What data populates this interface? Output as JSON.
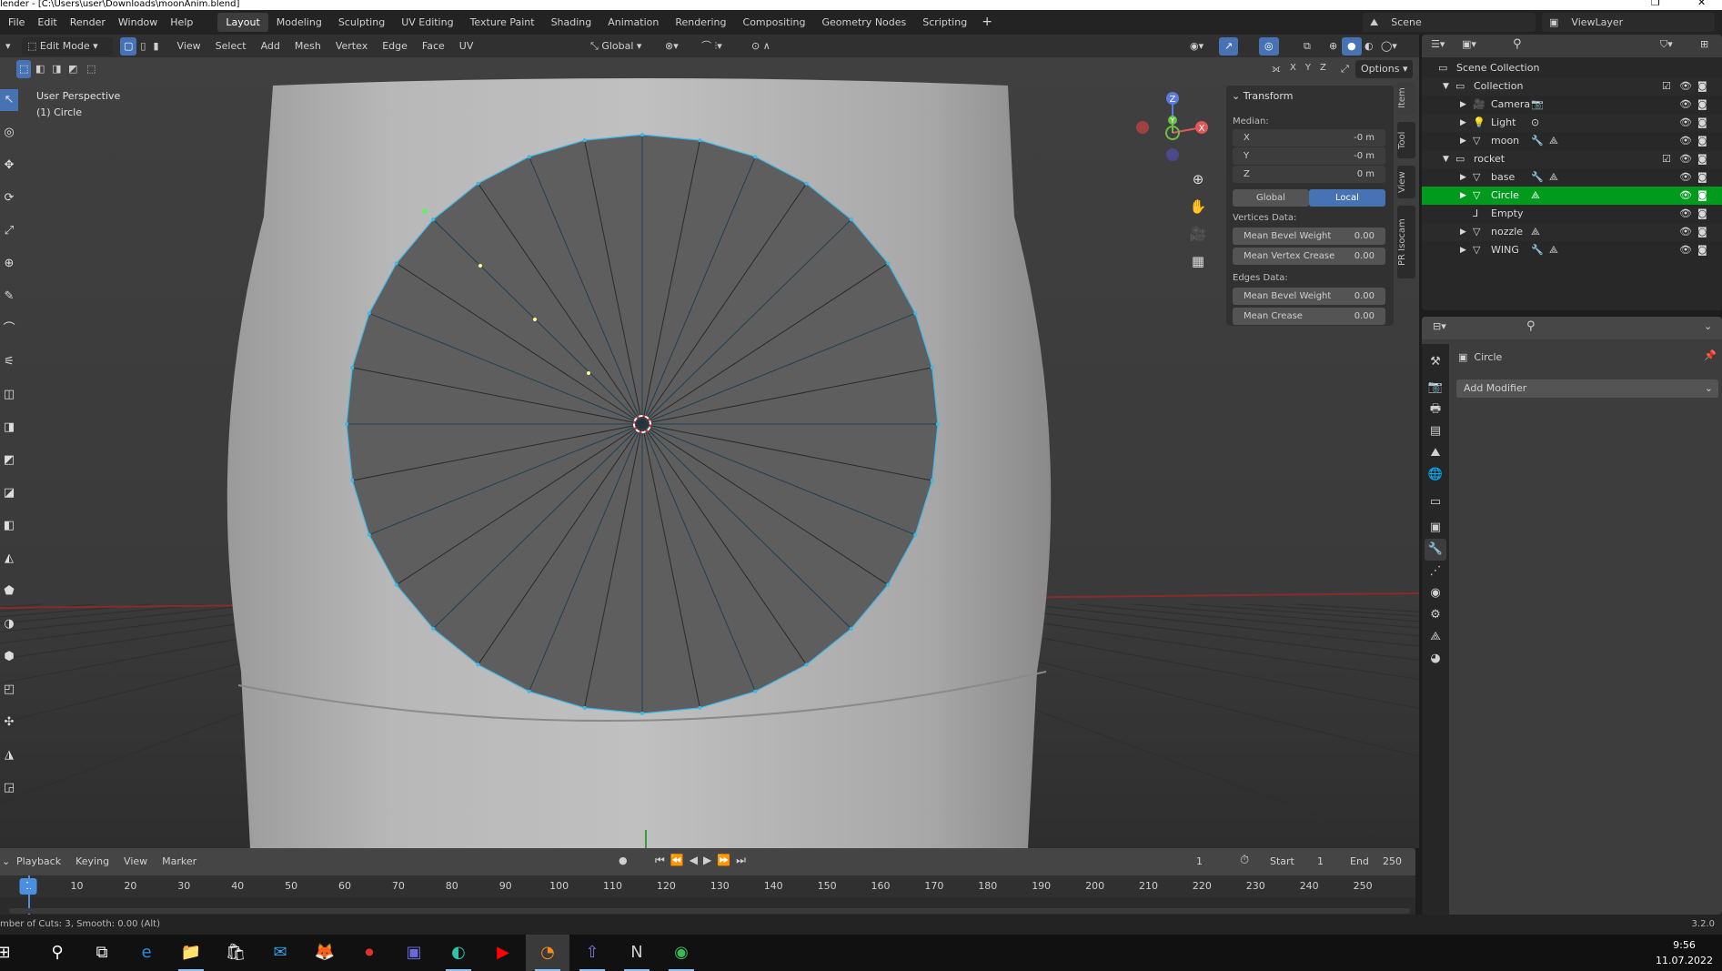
{
  "window": {
    "title": "lender - [C:\\Users\\user\\Downloads\\moonAnim.blend]"
  },
  "menu": [
    "File",
    "Edit",
    "Render",
    "Window",
    "Help"
  ],
  "workspaces": [
    {
      "label": "Layout",
      "active": true
    },
    {
      "label": "Modeling"
    },
    {
      "label": "Sculpting"
    },
    {
      "label": "UV Editing"
    },
    {
      "label": "Texture Paint"
    },
    {
      "label": "Shading"
    },
    {
      "label": "Animation"
    },
    {
      "label": "Rendering"
    },
    {
      "label": "Compositing"
    },
    {
      "label": "Geometry Nodes"
    },
    {
      "label": "Scripting"
    }
  ],
  "add_workspace": "+",
  "scene": {
    "label": "Scene",
    "view_layer": "ViewLayer"
  },
  "header": {
    "mode": "Edit Mode",
    "menus": [
      "View",
      "Select",
      "Add",
      "Mesh",
      "Vertex",
      "Edge",
      "Face",
      "UV"
    ],
    "orientation": "Global",
    "axes": [
      "X",
      "Y",
      "Z"
    ],
    "options": "Options"
  },
  "viewport": {
    "perspective": "User Perspective",
    "object": "(1) Circle",
    "gizmo": {
      "x": "X",
      "y": "Y",
      "z": "Z"
    },
    "colors": {
      "mesh_edge": "#3fb9e8",
      "selected_vertex": "#ffff80",
      "active_row": "#009a1c",
      "accent": "#4772b3"
    }
  },
  "npanel": {
    "section": "Transform",
    "median_label": "Median:",
    "median": [
      {
        "axis": "X",
        "value": "-0 m"
      },
      {
        "axis": "Y",
        "value": "-0 m"
      },
      {
        "axis": "Z",
        "value": "0 m"
      }
    ],
    "space": [
      "Global",
      "Local"
    ],
    "space_active": "Local",
    "vertices_label": "Vertices Data:",
    "vertices": [
      {
        "label": "Mean Bevel Weight",
        "value": "0.00"
      },
      {
        "label": "Mean Vertex Crease",
        "value": "0.00"
      }
    ],
    "edges_label": "Edges Data:",
    "edges": [
      {
        "label": "Mean Bevel Weight",
        "value": "0.00"
      },
      {
        "label": "Mean Crease",
        "value": "0.00"
      }
    ],
    "tabs": [
      "Item",
      "Tool",
      "View",
      "PR Isocam"
    ]
  },
  "outliner": {
    "rows": [
      {
        "label": "Scene Collection",
        "icon": "collection-icon",
        "indent": 0
      },
      {
        "label": "Collection",
        "icon": "collection-icon",
        "indent": 1,
        "expanded": true,
        "checkbox": true
      },
      {
        "label": "Camera",
        "icon": "camera-icon",
        "indent": 2,
        "extras": [
          "camera-data-icon"
        ]
      },
      {
        "label": "Light",
        "icon": "light-icon",
        "indent": 2,
        "extras": [
          "light-data-icon"
        ]
      },
      {
        "label": "moon",
        "icon": "mesh-icon",
        "indent": 2,
        "extras": [
          "wrench-icon",
          "mesh-data-icon"
        ]
      },
      {
        "label": "rocket",
        "icon": "collection-icon",
        "indent": 1,
        "expanded": true,
        "checkbox": true
      },
      {
        "label": "base",
        "icon": "mesh-icon",
        "indent": 2,
        "extras": [
          "wrench-icon",
          "mesh-data-icon"
        ]
      },
      {
        "label": "Circle",
        "icon": "mesh-icon",
        "indent": 2,
        "extras": [
          "mesh-data-icon"
        ],
        "selected": true
      },
      {
        "label": "Empty",
        "icon": "empty-icon",
        "indent": 2,
        "extras": []
      },
      {
        "label": "nozzle",
        "icon": "mesh-icon",
        "indent": 2,
        "extras": [
          "mesh-data-icon"
        ]
      },
      {
        "label": "WING",
        "icon": "mesh-icon",
        "indent": 2,
        "extras": [
          "wrench-icon",
          "mesh-data-icon"
        ]
      }
    ]
  },
  "properties": {
    "object": "Circle",
    "add_modifier": "Add Modifier",
    "active_tab": "modifier"
  },
  "timeline": {
    "menus": [
      "Playback",
      "Keying",
      "View",
      "Marker"
    ],
    "current_frame": "1",
    "start_label": "Start",
    "start": "1",
    "end_label": "End",
    "end": "250",
    "ticks": [
      "1",
      "10",
      "20",
      "30",
      "40",
      "50",
      "60",
      "70",
      "80",
      "90",
      "100",
      "110",
      "120",
      "130",
      "140",
      "150",
      "160",
      "170",
      "180",
      "190",
      "200",
      "210",
      "220",
      "230",
      "240",
      "250"
    ]
  },
  "status": {
    "message": "mber of Cuts: 3, Smooth: 0.00 (Alt)",
    "version": "3.2.0"
  },
  "taskbar": {
    "apps": [
      "start",
      "search",
      "task-view",
      "edge-legacy",
      "file-explorer",
      "store",
      "mail",
      "firefox",
      "recorder",
      "app-7",
      "edge",
      "youtube",
      "blender",
      "app-13",
      "notion",
      "chrome"
    ],
    "time": "9:56",
    "date": "11.07.2022"
  }
}
